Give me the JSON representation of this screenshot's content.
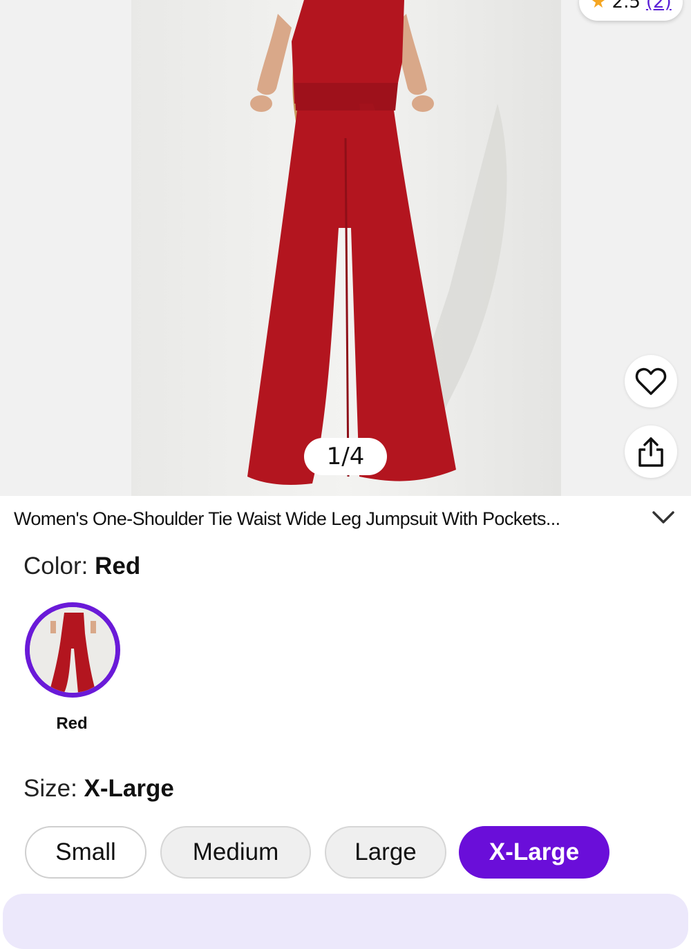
{
  "rating": {
    "value": "2.5",
    "count": "(2)",
    "icon": "star-icon"
  },
  "gallery": {
    "counter": "1/4",
    "favorite_icon": "heart-icon",
    "share_icon": "share-icon"
  },
  "product": {
    "title": "Women's One-Shoulder Tie Waist Wide Leg Jumpsuit With Pockets...",
    "expand_icon": "chevron-down-icon"
  },
  "color": {
    "label": "Color:",
    "selected": "Red",
    "options": [
      {
        "name": "Red"
      }
    ]
  },
  "size": {
    "label": "Size:",
    "selected": "X-Large",
    "options": [
      {
        "label": "Small"
      },
      {
        "label": "Medium"
      },
      {
        "label": "Large"
      },
      {
        "label": "X-Large"
      }
    ]
  },
  "colors": {
    "accent": "#6a0ed9",
    "product_red": "#b3151f",
    "rating_star": "#f5a623"
  }
}
